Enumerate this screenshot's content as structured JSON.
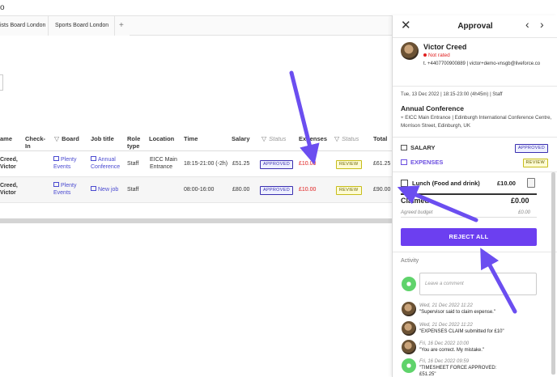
{
  "top_strip": {
    "text": "o"
  },
  "tabs": [
    {
      "label": "ists Board London"
    },
    {
      "label": "Sports Board London"
    },
    {
      "label": "+"
    }
  ],
  "table": {
    "headers": {
      "name": "ame",
      "checkin": "Check-\nIn",
      "board": "Board",
      "jobtitle": "Job title",
      "role": "Role\ntype",
      "location": "Location",
      "time": "Time",
      "salary": "Salary",
      "status1": "Status",
      "expenses": "Expenses",
      "status2": "Status",
      "total": "Total"
    },
    "rows": [
      {
        "name": "Creed,\nVictor",
        "board": "Plenty\nEvents",
        "job": "Annual\nConference",
        "role": "Staff",
        "location": "EICC Main\nEntrance",
        "time": "18:15-21:00 (-2h)",
        "salary": "£51.25",
        "status": "APPROVED",
        "expenses": "£10.00",
        "exp_status": "REVIEW",
        "total": "£61.25"
      },
      {
        "name": "Creed,\nVictor",
        "board": "Plenty\nEvents",
        "job": "New job",
        "role": "Staff",
        "location": "",
        "time": "08:00-16:00",
        "salary": "£80.00",
        "status": "APPROVED",
        "expenses": "£10.00",
        "exp_status": "REVIEW",
        "total": "£90.00"
      }
    ]
  },
  "panel": {
    "title": "Approval",
    "close_glyph": "✕",
    "prev_glyph": "‹",
    "next_glyph": "›",
    "user": {
      "name": "Victor Creed",
      "rating": "Not rated",
      "contact": "t. +4407700900889 | victor+demo-vnsgb@liveforce.co"
    },
    "shift": "Tue, 13 Dec 2022 | 18:15-23:00 (4h45m) | Staff",
    "event": "Annual Conference",
    "venue": "EICC Main Entrance | Edinburgh International Conference Centre, Morrison Street, Edinburgh, UK",
    "salary": {
      "label": "SALARY",
      "status": "APPROVED"
    },
    "expenses": {
      "label": "EXPENSES",
      "status": "REVIEW"
    },
    "item": {
      "name": "Lunch (Food and drink)",
      "amount": "£10.00"
    },
    "claimed": {
      "label": "Claimed",
      "amount": "£0.00"
    },
    "budget": {
      "label": "Agreed budget",
      "amount": "£0.00"
    },
    "reject_label": "REJECT ALL",
    "activity_label": "Activity",
    "comment_placeholder": "Leave a comment",
    "activity": [
      {
        "date": "Wed, 21 Dec 2022 11:22",
        "msg": "\"Supervisor said to claim expense.\""
      },
      {
        "date": "Wed, 21 Dec 2022 11:22",
        "msg": "\"EXPENSES CLAIM submitted for £10\""
      },
      {
        "date": "Fri, 16 Dec 2022 10:00",
        "msg": "\"You are correct. My mistake.\""
      },
      {
        "date": "Fri, 16 Dec 2022 09:59",
        "msg": "\"TIMESHEET FORCE APPROVED:\n£51.25\""
      }
    ]
  },
  "colors": {
    "accent": "#6c3ff0",
    "arrow": "#6b4ef0",
    "danger": "#e02020",
    "approved": "#3a2fb0",
    "review": "#c7bd1a"
  }
}
